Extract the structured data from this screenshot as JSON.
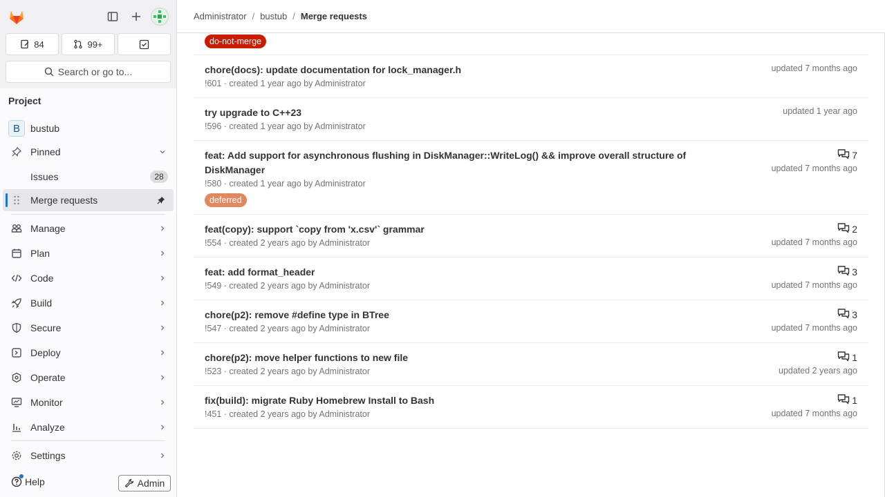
{
  "header": {
    "breadcrumb": [
      "Administrator",
      "bustub",
      "Merge requests"
    ]
  },
  "sidebar": {
    "counters": {
      "issues": "84",
      "merge_requests": "99+"
    },
    "search_label": "Search or go to...",
    "section_title": "Project",
    "project": {
      "initial": "B",
      "name": "bustub"
    },
    "pinned_label": "Pinned",
    "issues_label": "Issues",
    "issues_count": "28",
    "merge_requests_label": "Merge requests",
    "items": [
      {
        "label": "Manage",
        "icon": "manage-icon"
      },
      {
        "label": "Plan",
        "icon": "plan-icon"
      },
      {
        "label": "Code",
        "icon": "code-icon"
      },
      {
        "label": "Build",
        "icon": "rocket-icon"
      },
      {
        "label": "Secure",
        "icon": "shield-icon"
      },
      {
        "label": "Deploy",
        "icon": "deploy-icon"
      },
      {
        "label": "Operate",
        "icon": "cloud-gear-icon"
      },
      {
        "label": "Monitor",
        "icon": "monitor-icon"
      },
      {
        "label": "Analyze",
        "icon": "chart-icon"
      }
    ],
    "settings_label": "Settings",
    "help_label": "Help",
    "admin_label": "Admin"
  },
  "labels": {
    "do_not_merge": {
      "text": "do-not-merge",
      "color": "#c91c00"
    },
    "deferred": {
      "text": "deferred",
      "color": "#e2885f"
    }
  },
  "merge_requests": [
    {
      "title": "chore(docs): update documentation for lock_manager.h",
      "meta": "!601 · created 1 year ago by Administrator",
      "updated": "updated 7 months ago",
      "comments": ""
    },
    {
      "title": "try upgrade to C++23",
      "meta": "!596 · created 1 year ago by Administrator",
      "updated": "updated 1 year ago",
      "comments": ""
    },
    {
      "title": "feat: Add support for asynchronous flushing in DiskManager::WriteLog() && improve overall structure of DiskManager",
      "meta": "!580 · created 1 year ago by Administrator",
      "updated": "updated 7 months ago",
      "comments": "7"
    },
    {
      "title": "feat(copy): support `copy from 'x.csv'` grammar",
      "meta": "!554 · created 2 years ago by Administrator",
      "updated": "updated 7 months ago",
      "comments": "2"
    },
    {
      "title": "feat: add format_header",
      "meta": "!549 · created 2 years ago by Administrator",
      "updated": "updated 7 months ago",
      "comments": "3"
    },
    {
      "title": "chore(p2): remove #define type in BTree",
      "meta": "!547 · created 2 years ago by Administrator",
      "updated": "updated 7 months ago",
      "comments": "3"
    },
    {
      "title": "chore(p2): move helper functions to new file",
      "meta": "!523 · created 2 years ago by Administrator",
      "updated": "updated 2 years ago",
      "comments": "1"
    },
    {
      "title": "fix(build): migrate Ruby Homebrew Install to Bash",
      "meta": "!451 · created 2 years ago by Administrator",
      "updated": "updated 7 months ago",
      "comments": "1"
    }
  ]
}
